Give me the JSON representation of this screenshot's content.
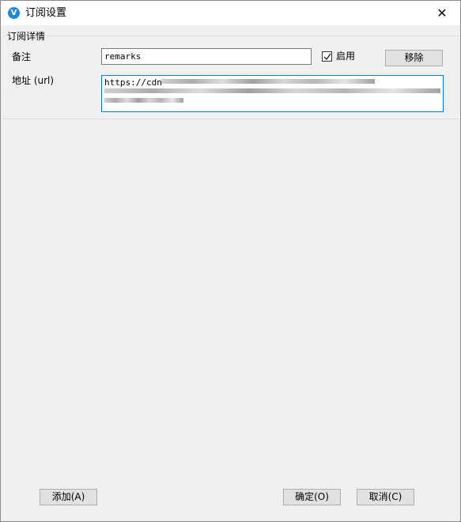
{
  "window": {
    "title": "订阅设置",
    "app_icon_glyph": "V",
    "close_glyph": "✕"
  },
  "group": {
    "legend": "订阅详情"
  },
  "fields": {
    "remarks_label": "备注",
    "remarks_value": "remarks",
    "enable_label": "启用",
    "enable_checked": true,
    "remove_button": "移除",
    "url_label": "地址 (url)",
    "url_value_prefix": "https://cdn"
  },
  "footer": {
    "add_button": "添加(A)",
    "ok_button": "确定(O)",
    "cancel_button": "取消(C)"
  },
  "colors": {
    "accent": "#0078d7",
    "app_icon": "#1e88e5"
  },
  "icons": {
    "app": "v2ray-logo-icon",
    "close": "close-icon",
    "check": "checkmark-icon"
  }
}
